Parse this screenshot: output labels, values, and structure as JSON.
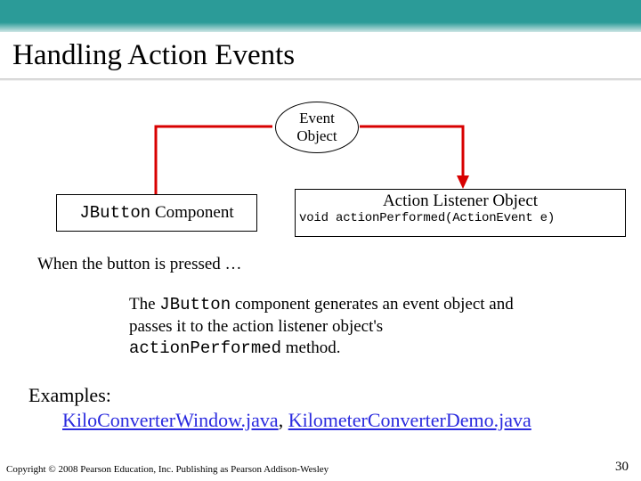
{
  "title": "Handling Action Events",
  "diagram": {
    "event_object_l1": "Event",
    "event_object_l2": "Object",
    "jbutton_pre": "JButton",
    "jbutton_post": " Component",
    "listener_title": "Action Listener Object",
    "listener_sig": "void actionPerformed(ActionEvent e)"
  },
  "when_text": "When the button is pressed …",
  "body": {
    "p1_a": "The ",
    "p1_code1": "JButton",
    "p1_b": " component generates an event object and passes it to the action listener object's ",
    "p1_code2": "actionPerformed",
    "p1_c": " method."
  },
  "examples": {
    "label": "Examples:",
    "link1": "KiloConverterWindow.java",
    "sep": ", ",
    "link2": "KilometerConverterDemo.java"
  },
  "footer": "Copyright © 2008 Pearson Education, Inc. Publishing as Pearson Addison-Wesley",
  "slide_number": "30"
}
